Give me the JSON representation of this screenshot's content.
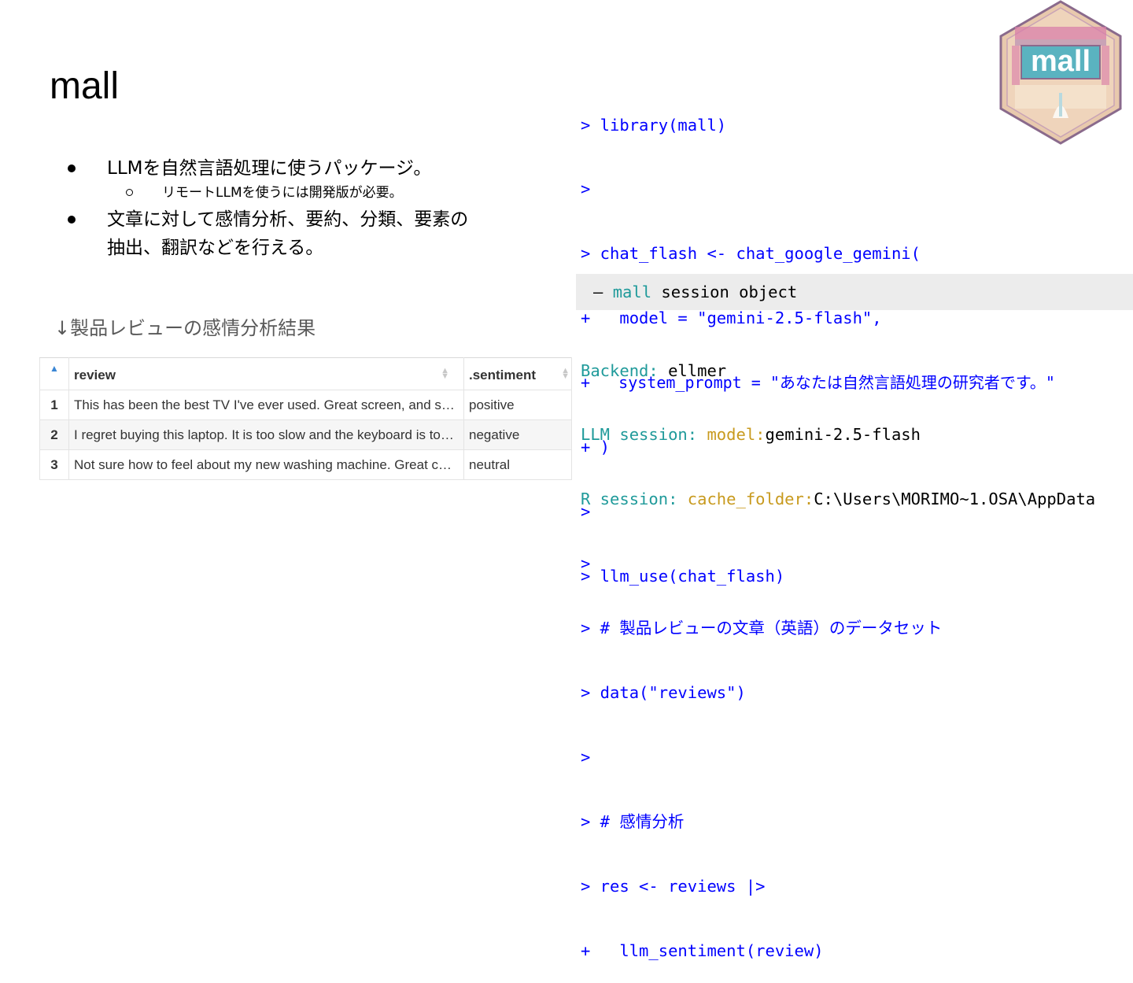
{
  "slide": {
    "title": "mall",
    "bullets": [
      {
        "text": "LLMを自然言語処理に使うパッケージ。",
        "sub": [
          "リモートLLMを使うには開発版が必要。"
        ]
      },
      {
        "text": "文章に対して感情分析、要約、分類、要素の",
        "text2": "抽出、翻訳などを行える。"
      }
    ],
    "caption": "↓製品レビューの感情分析結果"
  },
  "table": {
    "columns": [
      "review",
      ".sentiment"
    ],
    "rows": [
      {
        "idx": "1",
        "review": "This has been the best TV I've ever used. Great screen, and sound.",
        "sentiment": "positive"
      },
      {
        "idx": "2",
        "review": "I regret buying this laptop. It is too slow and the keyboard is too noisy",
        "sentiment": "negative"
      },
      {
        "idx": "3",
        "review": "Not sure how to feel about my new washing machine. Great color, but hard to figure",
        "sentiment": "neutral"
      }
    ]
  },
  "console": {
    "lines": [
      "> library(mall)",
      ">",
      "> chat_flash <- chat_google_gemini(",
      "+   model = \"gemini-2.5-flash\",",
      "+   system_prompt = \"あなたは自然言語処理の研究者です。\"",
      "+ )",
      ">",
      "> llm_use(chat_flash)"
    ],
    "session_dash": "—",
    "session_pkg": "mall",
    "session_rest": " session object",
    "backend_key": "Backend:",
    "backend_val": " ellmer",
    "llm_key": "LLM session: ",
    "llm_sub": "model:",
    "llm_val": "gemini-2.5-flash",
    "r_key": "R session: ",
    "r_sub": "cache_folder:",
    "r_val": "C:\\Users\\MORIMO~1.OSA\\AppData",
    "lines2": [
      ">",
      "> # 製品レビューの文章（英語）のデータセット",
      "> data(\"reviews\")",
      ">",
      "> # 感情分析",
      "> res <- reviews |>",
      "+   llm_sentiment(review)"
    ]
  },
  "logo": {
    "text": "mall",
    "colors": {
      "border": "#8a6a8c",
      "bg": "#e8c9ad",
      "banner": "#5ab3c0",
      "pink": "#d97aa8"
    }
  }
}
